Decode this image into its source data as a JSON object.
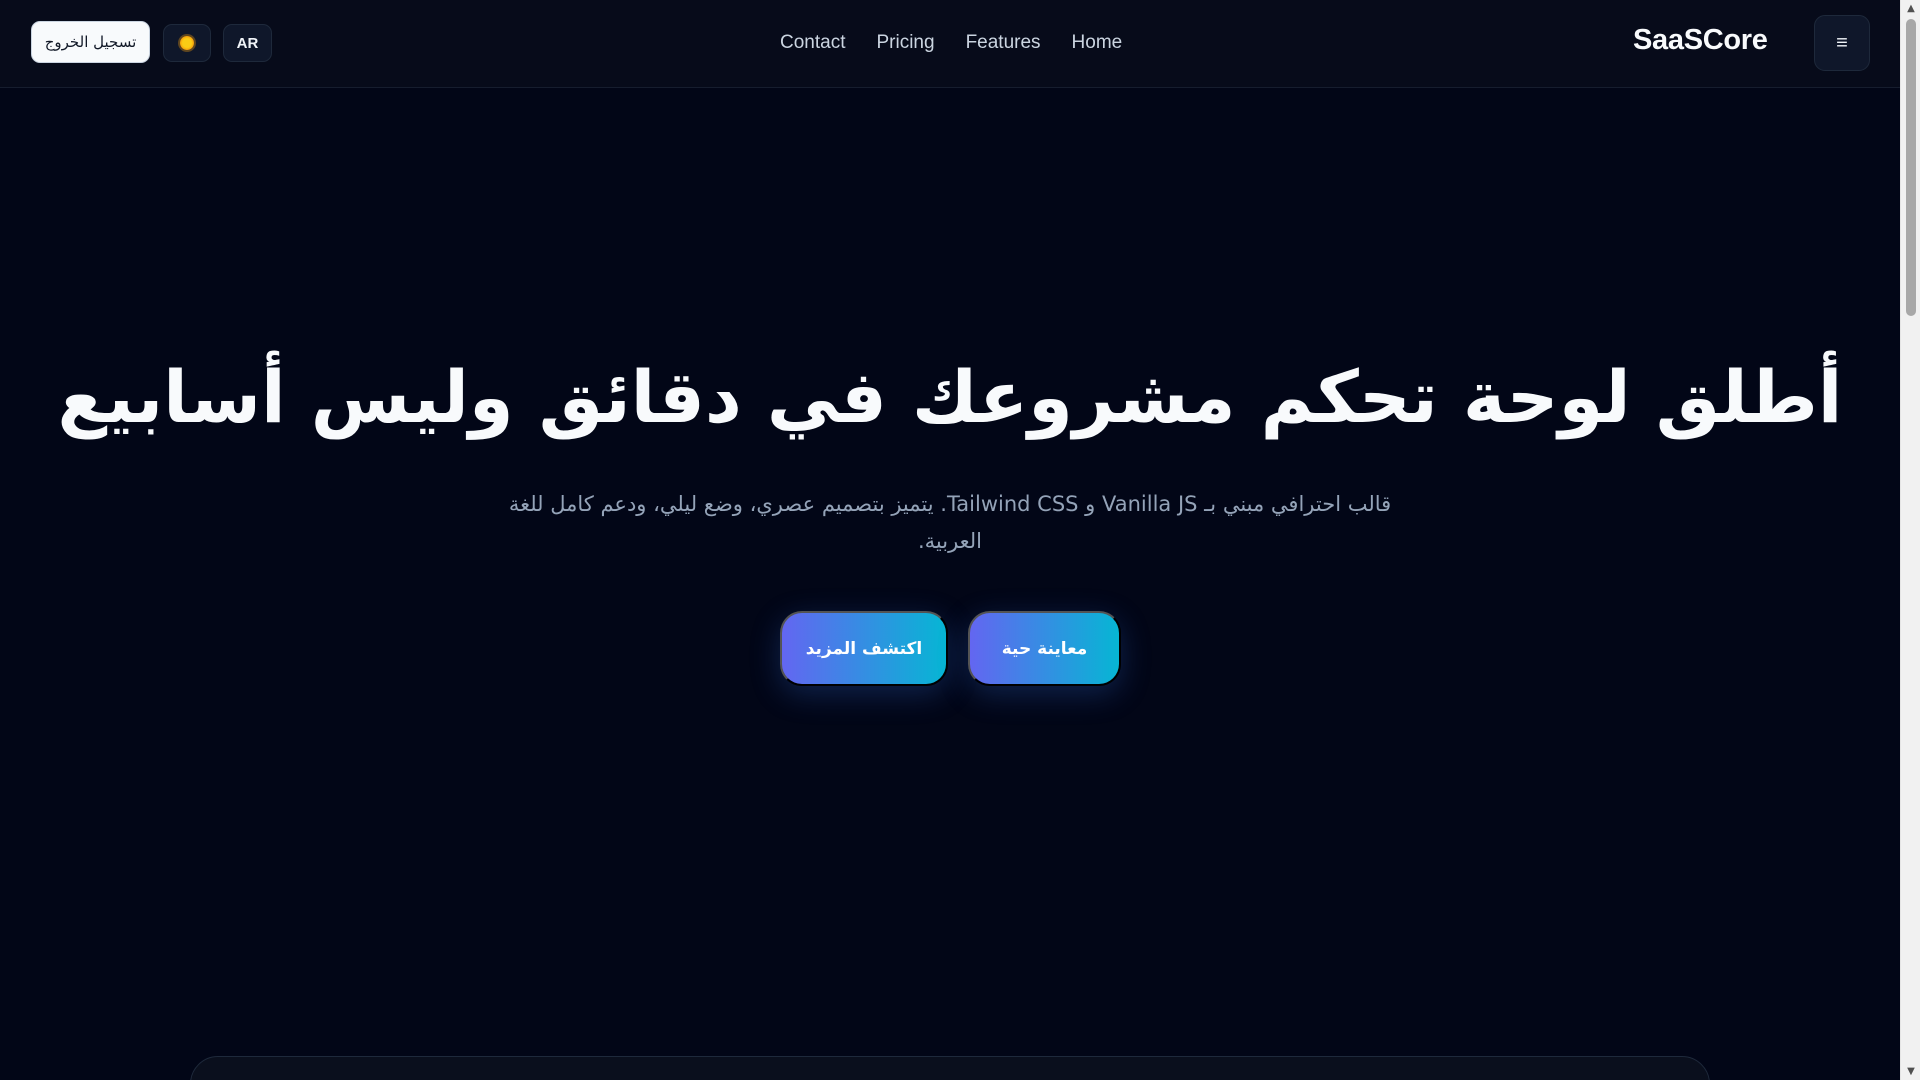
{
  "header": {
    "logout_label": "تسجيل الخروج",
    "theme_icon": "sun-icon",
    "lang_label": "AR",
    "nav": [
      "Contact",
      "Pricing",
      "Features",
      "Home"
    ],
    "brand": "SaaSCore",
    "menu_icon": "≡"
  },
  "hero": {
    "title": "أطلق لوحة تحكم مشروعك في دقائق وليس أسابيع",
    "subtitle": "قالب احترافي مبني بـ Vanilla JS و Tailwind CSS. يتميز بتصميم عصري، وضع ليلي، ودعم كامل للغة العربية.",
    "cta_explore": "اكتشف المزيد",
    "cta_preview": "معاينة حية"
  },
  "colors": {
    "background": "#020617",
    "header_bg": "#070b1a",
    "gradient_start": "#6366f1",
    "gradient_end": "#06b6d4"
  }
}
